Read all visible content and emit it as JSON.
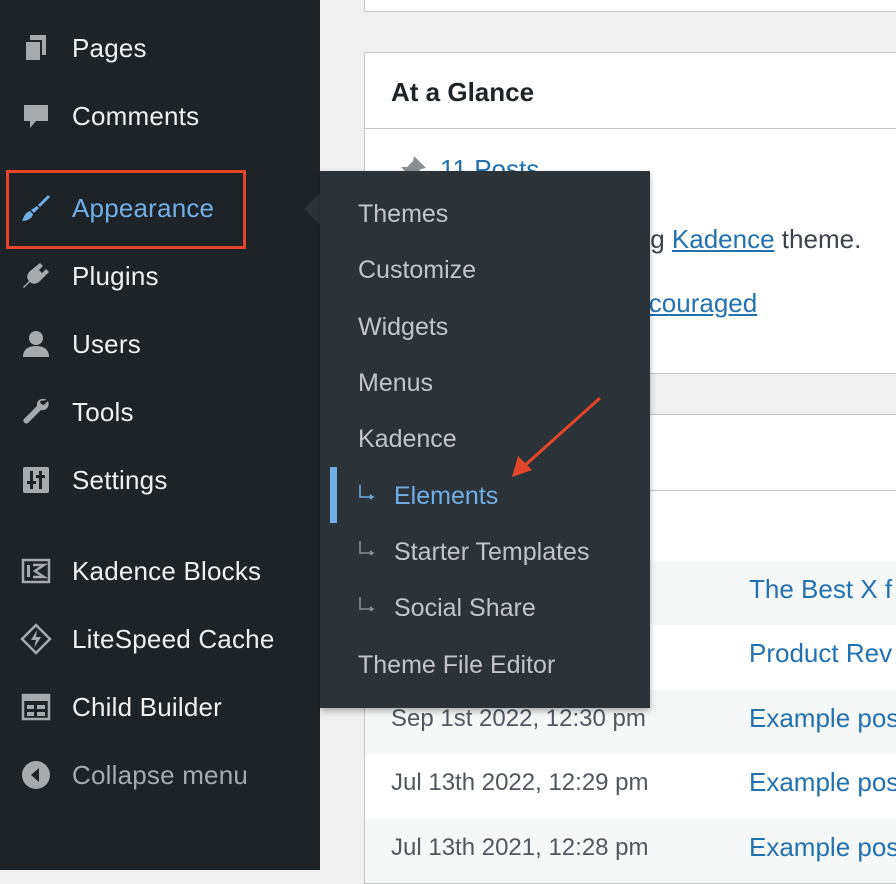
{
  "sidebar": {
    "items": [
      {
        "label": "Pages",
        "icon": "pages-icon"
      },
      {
        "label": "Comments",
        "icon": "comments-icon"
      },
      {
        "label": "Appearance",
        "icon": "paintbrush-icon"
      },
      {
        "label": "Plugins",
        "icon": "plugin-icon"
      },
      {
        "label": "Users",
        "icon": "users-icon"
      },
      {
        "label": "Tools",
        "icon": "wrench-icon"
      },
      {
        "label": "Settings",
        "icon": "settings-icon"
      },
      {
        "label": "Kadence Blocks",
        "icon": "kadence-blocks-icon"
      },
      {
        "label": "LiteSpeed Cache",
        "icon": "litespeed-icon"
      },
      {
        "label": "Child Builder",
        "icon": "child-builder-icon"
      },
      {
        "label": "Collapse menu",
        "icon": "collapse-icon"
      }
    ]
  },
  "submenu": {
    "items": [
      {
        "label": "Themes"
      },
      {
        "label": "Customize"
      },
      {
        "label": "Widgets"
      },
      {
        "label": "Menus"
      },
      {
        "label": "Kadence"
      },
      {
        "label": "Elements"
      },
      {
        "label": "Starter Templates"
      },
      {
        "label": "Social Share"
      },
      {
        "label": "Theme File Editor"
      }
    ]
  },
  "glance": {
    "title": "At a Glance",
    "posts": "11 Posts",
    "theme_prefix": "ing ",
    "theme_name": "Kadence",
    "theme_suffix": " theme.",
    "discouraged": "iscouraged"
  },
  "activity": {
    "rows": [
      {
        "date": "",
        "post": "The Best X f"
      },
      {
        "date": "",
        "post": "Product Rev"
      },
      {
        "date": "Sep 1st 2022, 12:30 pm",
        "post": "Example pos"
      },
      {
        "date": "Jul 13th 2022, 12:29 pm",
        "post": "Example pos"
      },
      {
        "date": "Jul 13th 2021, 12:28 pm",
        "post": "Example pos"
      }
    ]
  },
  "colors": {
    "sidebar_bg": "#1d2327",
    "flyout_bg": "#2c3338",
    "accent": "#72aee6",
    "link": "#2271b1",
    "highlight": "#e2452b"
  }
}
